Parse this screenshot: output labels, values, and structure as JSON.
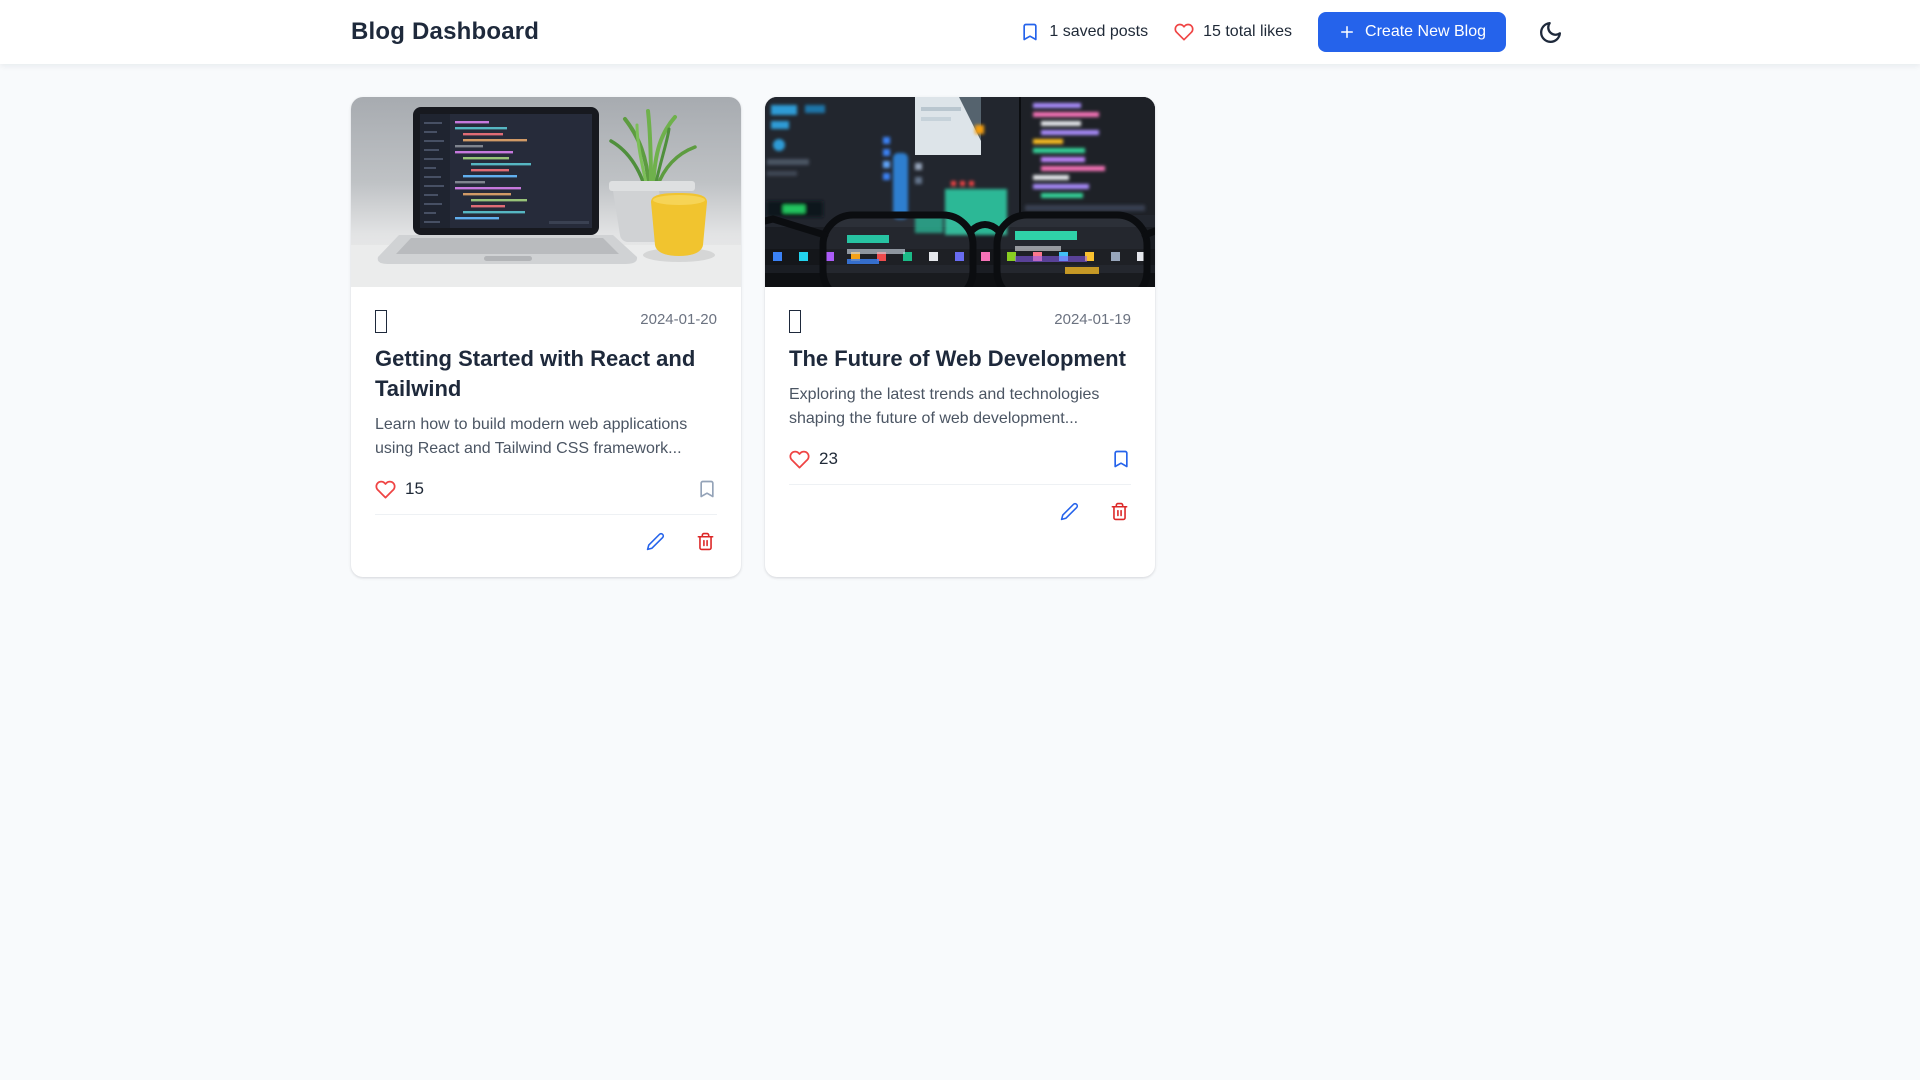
{
  "header": {
    "title": "Blog Dashboard",
    "stats": {
      "saved_posts": "1 saved posts",
      "total_likes": "15 total likes"
    },
    "create_button_label": "Create New Blog"
  },
  "icons": {
    "header_bookmark": "bookmark-icon",
    "header_heart": "heart-icon",
    "create_plus": "plus-icon",
    "theme_moon": "moon-icon",
    "card_edit": "pencil-icon",
    "card_delete": "trash-icon"
  },
  "colors": {
    "accent_blue": "#2563eb",
    "like_red": "#ef4444",
    "delete_red": "#dc2626",
    "page_bg": "#f8fafc",
    "card_bg": "#ffffff"
  },
  "posts": [
    {
      "date": "2024-01-20",
      "title": "Getting Started with React and Tailwind",
      "excerpt": "Learn how to build modern web applications using React and Tailwind CSS framework...",
      "likes": "15",
      "saved": false,
      "cover_alt": "laptop-with-code-photo"
    },
    {
      "date": "2024-01-19",
      "title": "The Future of Web Development",
      "excerpt": "Exploring the latest trends and technologies shaping the future of web development...",
      "likes": "23",
      "saved": true,
      "cover_alt": "monitors-code-and-glasses-photo"
    }
  ]
}
